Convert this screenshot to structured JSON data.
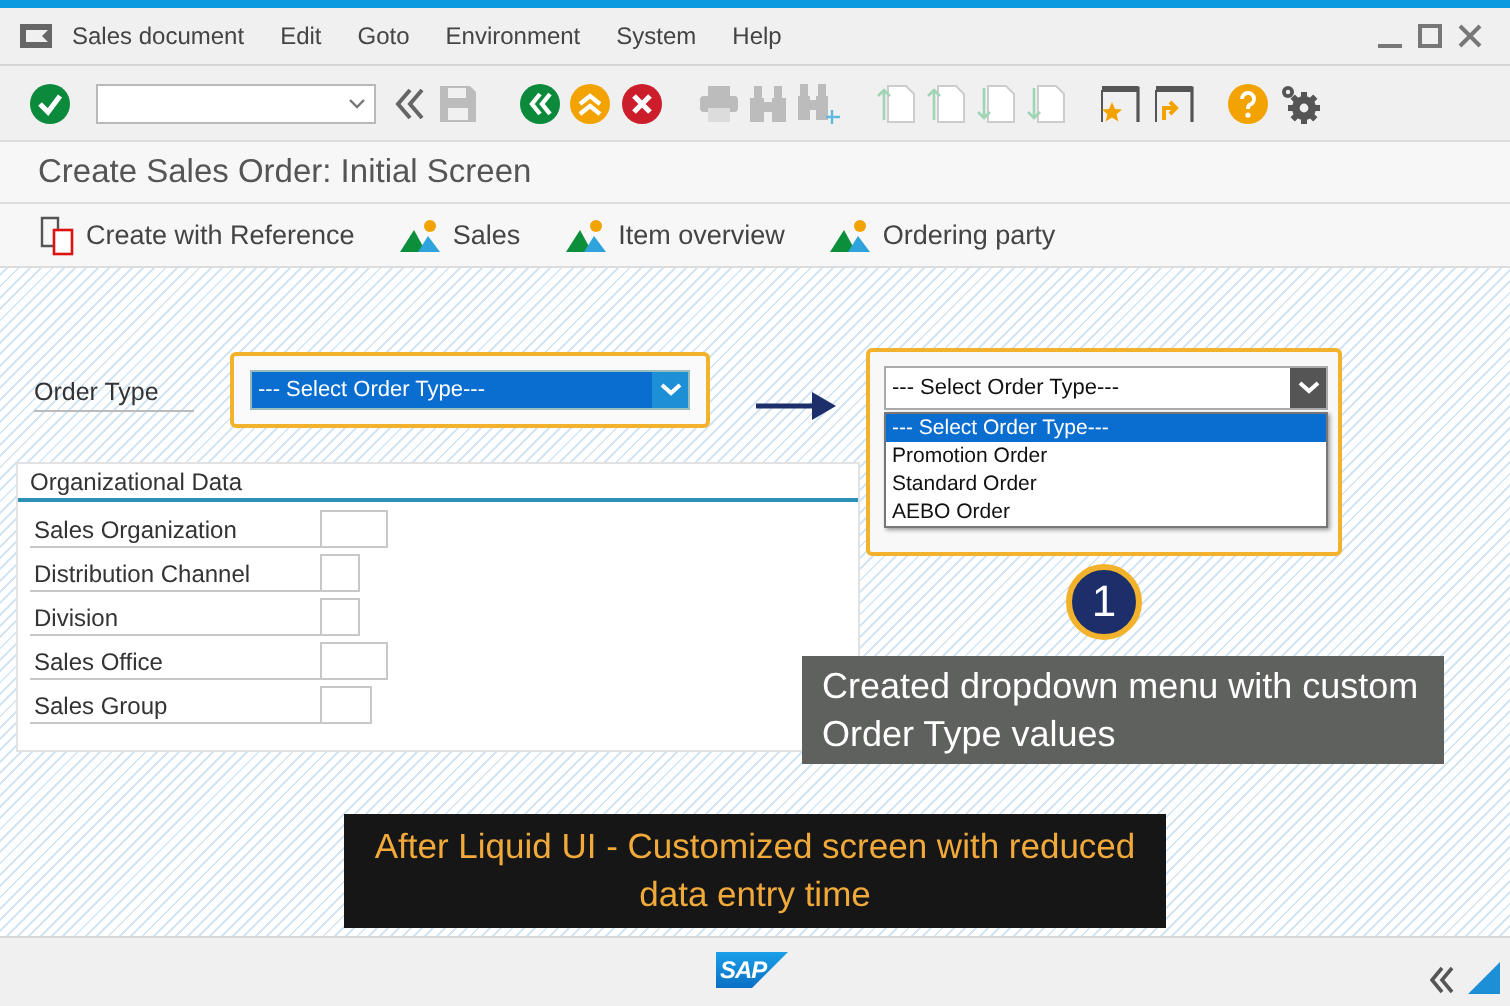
{
  "menu": [
    {
      "label": "Sales document"
    },
    {
      "label": "Edit"
    },
    {
      "label": "Goto"
    },
    {
      "label": "Environment"
    },
    {
      "label": "System"
    },
    {
      "label": "Help"
    }
  ],
  "title": "Create Sales Order: Initial Screen",
  "app_toolbar": [
    {
      "label": "Create with Reference",
      "kind": "reference"
    },
    {
      "label": "Sales",
      "kind": "overview"
    },
    {
      "label": "Item overview",
      "kind": "overview"
    },
    {
      "label": "Ordering party",
      "kind": "overview"
    }
  ],
  "order_type": {
    "label": "Order Type",
    "value": "--- Select Order Type---"
  },
  "org_data": {
    "title": "Organizational Data",
    "fields": [
      {
        "label": "Sales Organization"
      },
      {
        "label": "Distribution Channel"
      },
      {
        "label": "Division"
      },
      {
        "label": "Sales Office"
      },
      {
        "label": "Sales Group"
      }
    ]
  },
  "annotation": {
    "dropdown": {
      "value": "--- Select Order Type---",
      "options": [
        {
          "label": "--- Select Order Type---",
          "selected": true
        },
        {
          "label": "Promotion Order",
          "selected": false
        },
        {
          "label": "Standard Order",
          "selected": false
        },
        {
          "label": "AEBO Order",
          "selected": false
        }
      ]
    },
    "step": "1",
    "note": "Created dropdown menu with custom Order Type values"
  },
  "banner": "After Liquid UI - Customized screen with reduced data entry time",
  "status_bar": {
    "logo": "SAP"
  }
}
